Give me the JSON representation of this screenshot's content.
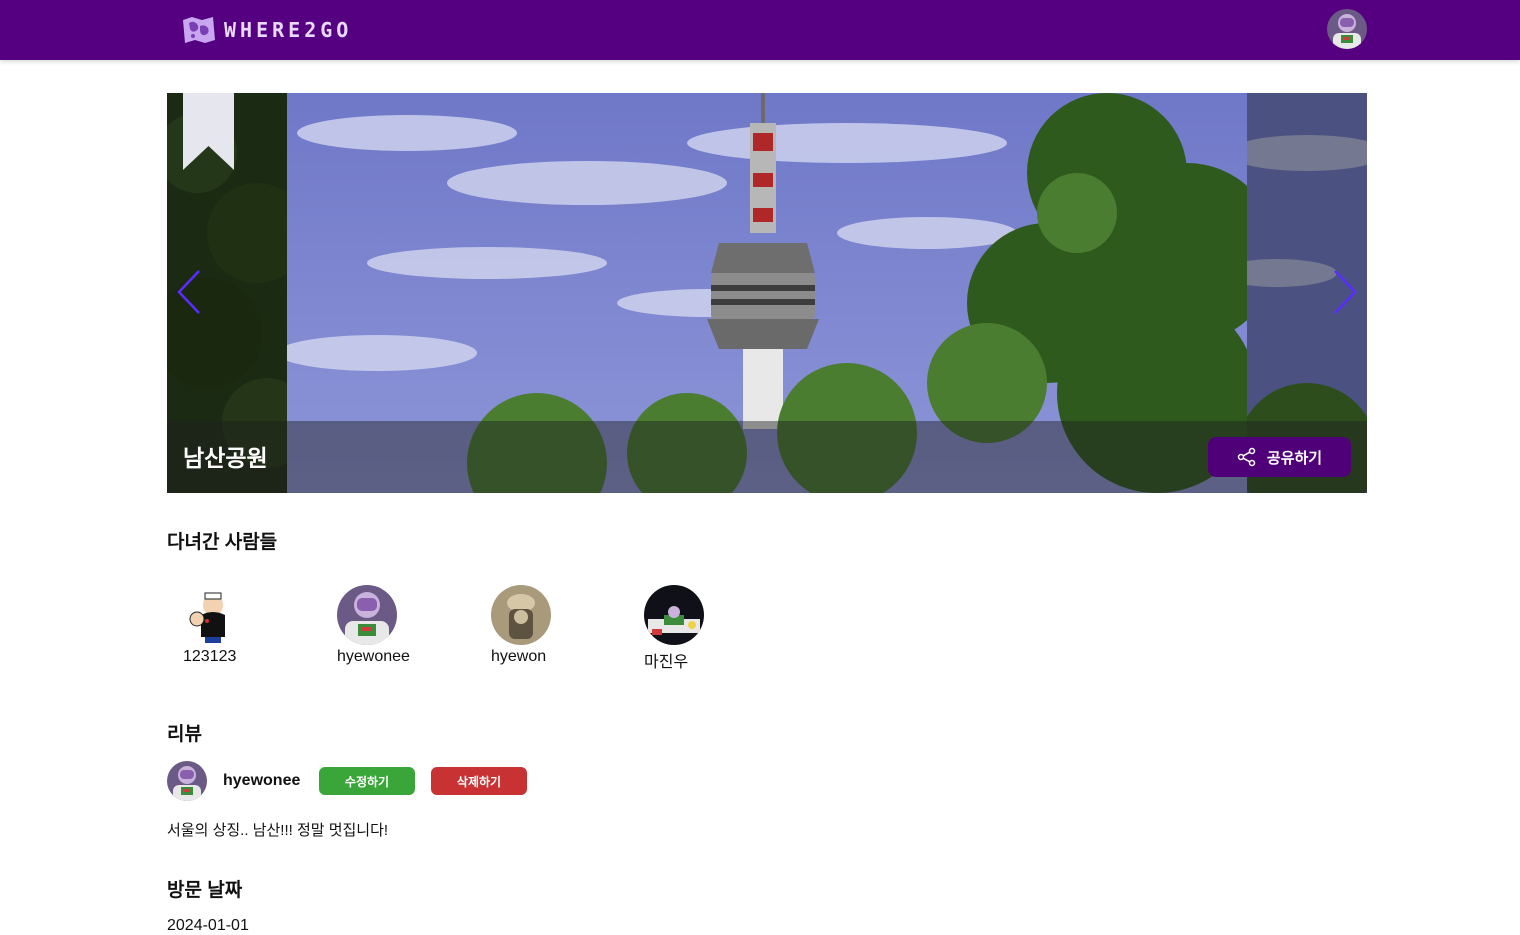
{
  "header": {
    "logo_text": "WHERE2GO",
    "logo_icon": "world-map-icon",
    "profile_avatar": "buzz-lightyear-avatar"
  },
  "hero": {
    "place_name": "남산공원",
    "share_label": "공유하기",
    "share_icon": "share-icon",
    "bookmark_icon": "bookmark-icon",
    "prev_icon": "chevron-left-icon",
    "next_icon": "chevron-right-icon"
  },
  "visitors_section": {
    "title": "다녀간 사람들",
    "visitors": [
      {
        "name": "123123",
        "avatar": "popeye-avatar"
      },
      {
        "name": "hyewonee",
        "avatar": "buzz-lightyear-avatar"
      },
      {
        "name": "hyewon",
        "avatar": "photo-avatar"
      },
      {
        "name": "마진우",
        "avatar": "buzz-night-avatar"
      }
    ]
  },
  "review_section": {
    "title": "리뷰",
    "user": "hyewonee",
    "edit_label": "수정하기",
    "delete_label": "삭제하기",
    "text": "서울의 상징.. 남산!!! 정말 멋집니다!"
  },
  "visit_section": {
    "title": "방문 날짜",
    "date": "2024-01-01"
  },
  "colors": {
    "topbar": "#550080",
    "share_button": "#4f0078",
    "edit_button": "#3aa63a",
    "delete_button": "#c83232",
    "arrow": "#5b2cff"
  }
}
